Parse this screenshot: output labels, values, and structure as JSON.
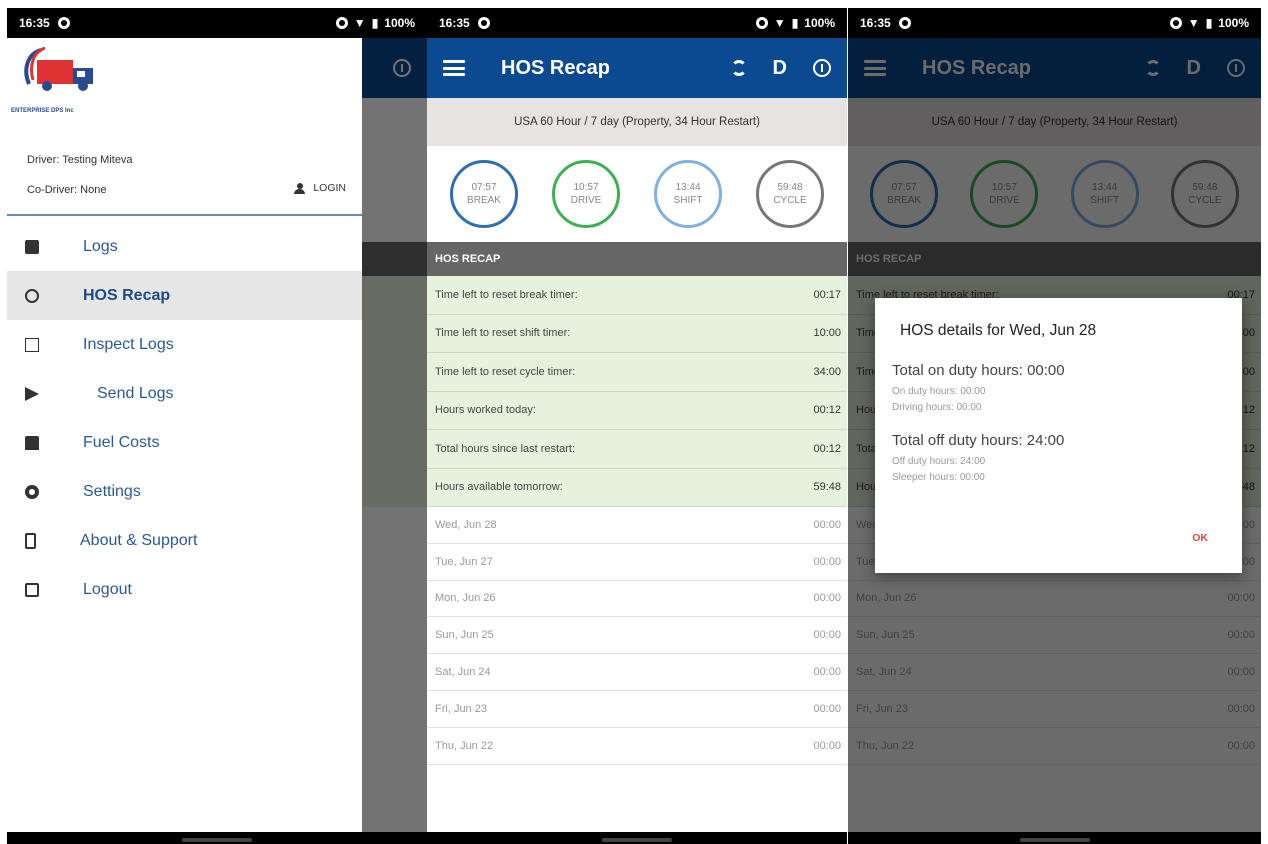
{
  "status": {
    "time": "16:35",
    "battery": "100%"
  },
  "appbar": {
    "title": "HOS Recap",
    "duty_status": "D"
  },
  "rule": "USA 60 Hour / 7 day (Property, 34 Hour Restart)",
  "gauges": [
    {
      "value": "07:57",
      "label": "BREAK"
    },
    {
      "value": "10:57",
      "label": "DRIVE"
    },
    {
      "value": "13:44",
      "label": "SHIFT"
    },
    {
      "value": "59:48",
      "label": "CYCLE"
    }
  ],
  "section_title": "HOS RECAP",
  "recap_rows": [
    {
      "label": "Time left to reset break timer:",
      "value": "00:17"
    },
    {
      "label": "Time left to reset shift timer:",
      "value": "10:00"
    },
    {
      "label": "Time left to reset cycle timer:",
      "value": "34:00"
    },
    {
      "label": "Hours worked today:",
      "value": "00:12"
    },
    {
      "label": "Total hours since last restart:",
      "value": "00:12"
    },
    {
      "label": "Hours available tomorrow:",
      "value": "59:48"
    }
  ],
  "day_rows": [
    {
      "label": "Wed, Jun 28",
      "value": "00:00"
    },
    {
      "label": "Tue, Jun 27",
      "value": "00:00"
    },
    {
      "label": "Mon, Jun 26",
      "value": "00:00"
    },
    {
      "label": "Sun, Jun 25",
      "value": "00:00"
    },
    {
      "label": "Sat, Jun 24",
      "value": "00:00"
    },
    {
      "label": "Fri, Jun 23",
      "value": "00:00"
    },
    {
      "label": "Thu, Jun 22",
      "value": "00:00"
    }
  ],
  "drawer": {
    "company": "ENTERPRISE DPS Inc",
    "driver": "Driver: Testing Miteva",
    "codriver": "Co-Driver: None",
    "login": "LOGIN",
    "items": [
      {
        "label": "Logs",
        "icon": "logs-icon"
      },
      {
        "label": "HOS Recap",
        "icon": "alarm-icon"
      },
      {
        "label": "Inspect Logs",
        "icon": "inspect-icon"
      },
      {
        "label": "Send Logs",
        "icon": "send-icon"
      },
      {
        "label": "Fuel Costs",
        "icon": "fuel-icon"
      },
      {
        "label": "Settings",
        "icon": "gear-icon"
      },
      {
        "label": "About & Support",
        "icon": "phone-icon"
      },
      {
        "label": "Logout",
        "icon": "logout-icon"
      }
    ]
  },
  "dialog": {
    "title": "HOS details for Wed, Jun 28",
    "on_duty_total": "Total on duty hours: 00:00",
    "on_duty": "On duty hours: 00:00",
    "driving": "Driving hours: 00:00",
    "off_duty_total": "Total off duty hours: 24:00",
    "off_duty": "Off duty hours: 24:00",
    "sleeper": "Sleeper hours: 00:00",
    "ok": "OK"
  },
  "colors": {
    "primary": "#0b4a91",
    "recap_green": "#e4f2de",
    "ok_red": "#e04a3a"
  }
}
